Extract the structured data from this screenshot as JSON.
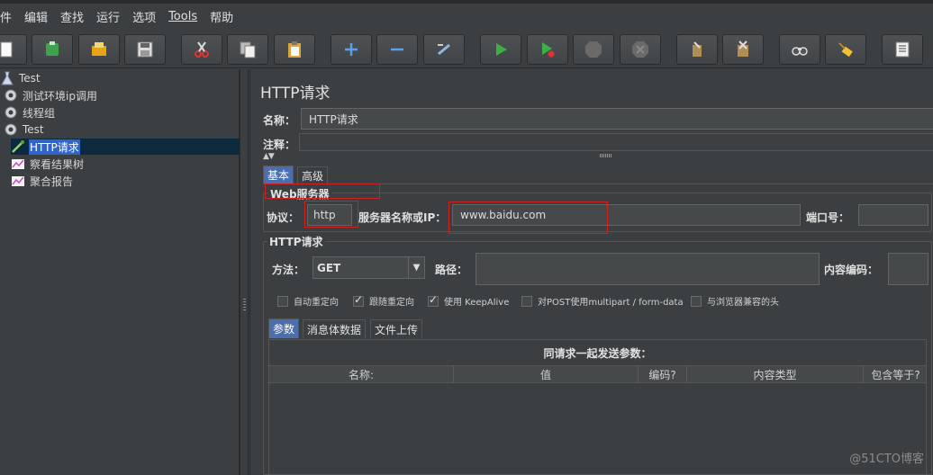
{
  "menu": [
    "件",
    "编辑",
    "查找",
    "运行",
    "选项",
    "Tools",
    "帮助"
  ],
  "toolbar": {
    "icons": [
      "new-icon",
      "templates-icon",
      "open-icon",
      "save-icon",
      "cut-icon",
      "copy-icon",
      "paste-icon",
      "expand-icon",
      "collapse-icon",
      "toggle-icon",
      "start-icon",
      "start-no-pause-icon",
      "stop-icon",
      "shutdown-icon",
      "clear-icon",
      "clear-all-icon",
      "search-icon",
      "reset-search-icon",
      "function-helper-icon"
    ]
  },
  "tree": {
    "items": [
      {
        "label": "Test",
        "icon": "testplan-icon",
        "indent": 0
      },
      {
        "label": "测试环境ip调用",
        "icon": "threadgroup-icon",
        "indent": 1
      },
      {
        "label": "线程组",
        "icon": "threadgroup-icon",
        "indent": 1
      },
      {
        "label": "Test",
        "icon": "threadgroup-icon",
        "indent": 1
      },
      {
        "label": "HTTP请求",
        "icon": "sampler-icon",
        "indent": 2,
        "selected": true
      },
      {
        "label": "察看结果树",
        "icon": "listener-icon",
        "indent": 2
      },
      {
        "label": "聚合报告",
        "icon": "listener-icon",
        "indent": 2
      }
    ]
  },
  "main": {
    "title": "HTTP请求",
    "name_label": "名称：",
    "name_value": "HTTP请求",
    "comment_label": "注释：",
    "comment_value": "",
    "tabs": [
      "基本",
      "高级"
    ],
    "web_server": {
      "title": "Web服务器",
      "protocol_label": "协议：",
      "protocol_value": "http",
      "server_label": "服务器名称或IP：",
      "server_value": "www.baidu.com",
      "port_label": "端口号：",
      "port_value": ""
    },
    "http_request": {
      "title": "HTTP请求",
      "method_label": "方法：",
      "method_value": "GET",
      "path_label": "路径：",
      "path_value": "",
      "encoding_label": "内容编码：",
      "encoding_value": "",
      "checkboxes": [
        {
          "label": "自动重定向",
          "checked": false
        },
        {
          "label": "跟随重定向",
          "checked": true
        },
        {
          "label": "使用 KeepAlive",
          "checked": true
        },
        {
          "label": "对POST使用multipart / form-data",
          "checked": false
        },
        {
          "label": "与浏览器兼容的头",
          "checked": false
        }
      ]
    },
    "subtabs": [
      "参数",
      "消息体数据",
      "文件上传"
    ],
    "params": {
      "caption": "同请求一起发送参数：",
      "columns": [
        "名称:",
        "值",
        "编码?",
        "内容类型",
        "包含等于?"
      ]
    }
  },
  "watermark": "@51CTO博客",
  "colors": {
    "selection": "#2f65ca",
    "highlight_box": "#d02020",
    "active_tab": "#4b6eaf"
  }
}
